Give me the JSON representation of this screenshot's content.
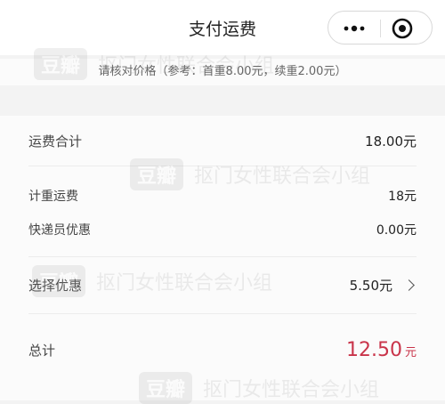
{
  "nav": {
    "title": "支付运费"
  },
  "hint": "请核对价格（参考：首重8.00元，续重2.00元）",
  "summary": {
    "label": "运费合计",
    "value": "18.00元"
  },
  "details": [
    {
      "label": "计重运费",
      "value": "18元"
    },
    {
      "label": "快递员优惠",
      "value": "0.00元"
    }
  ],
  "coupon": {
    "label": "选择优惠",
    "value": "5.50元"
  },
  "total": {
    "label": "总计",
    "amount": "12.50",
    "unit": "元"
  },
  "watermark": {
    "badge": "豆瓣",
    "text": "抠门女性联合会小组"
  },
  "colors": {
    "accent": "#c9344a"
  }
}
